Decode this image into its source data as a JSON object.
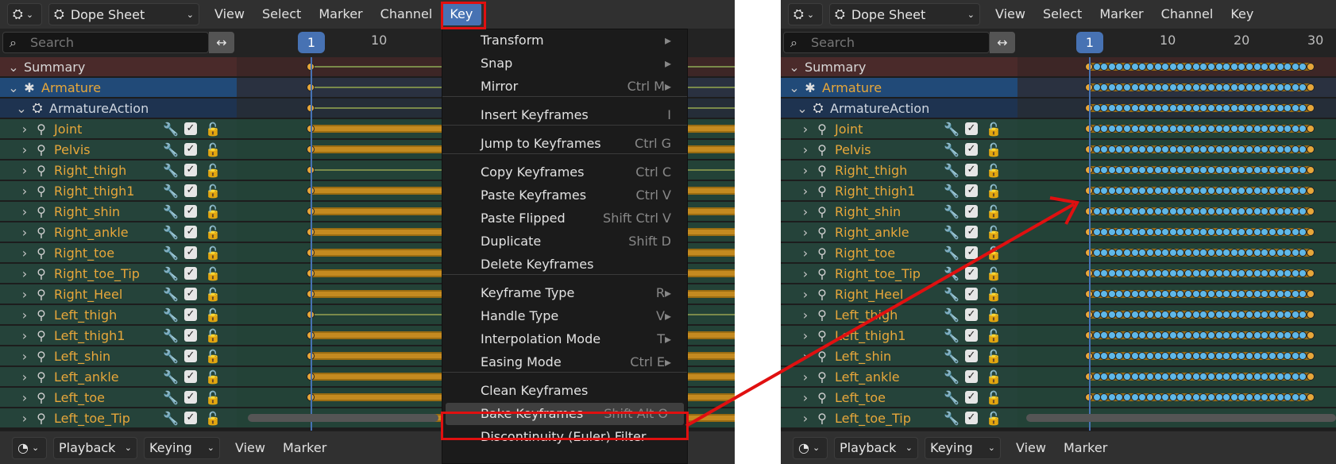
{
  "header": {
    "editor_icon": "dope-sheet-icon",
    "editor_type": "Dope Sheet",
    "menus": [
      "View",
      "Select",
      "Marker",
      "Channel",
      "Key"
    ]
  },
  "search": {
    "placeholder": "Search",
    "swap_icon": "↔"
  },
  "timeline": {
    "current_frame": "1",
    "left_ticks": [
      "10"
    ],
    "right_ticks": [
      "10",
      "20",
      "30"
    ]
  },
  "channels": {
    "summary": "Summary",
    "object": "Armature",
    "action": "ArmatureAction",
    "bones": [
      "Joint",
      "Pelvis",
      "Right_thigh",
      "Right_thigh1",
      "Right_shin",
      "Right_ankle",
      "Right_toe",
      "Right_toe_Tip",
      "Right_Heel",
      "Left_thigh",
      "Left_thigh1",
      "Left_shin",
      "Left_ankle",
      "Left_toe",
      "Left_toe_Tip"
    ]
  },
  "key_menu": {
    "items": [
      {
        "label": "Transform",
        "shortcut": "▸"
      },
      {
        "label": "Snap",
        "shortcut": "▸"
      },
      {
        "label": "Mirror",
        "shortcut": "Ctrl M▸"
      },
      {
        "label": "Insert Keyframes",
        "shortcut": "I"
      },
      {
        "label": "Jump to Keyframes",
        "shortcut": "Ctrl G"
      },
      {
        "label": "Copy Keyframes",
        "shortcut": "Ctrl C"
      },
      {
        "label": "Paste Keyframes",
        "shortcut": "Ctrl V"
      },
      {
        "label": "Paste Flipped",
        "shortcut": "Shift Ctrl V"
      },
      {
        "label": "Duplicate",
        "shortcut": "Shift D"
      },
      {
        "label": "Delete Keyframes",
        "shortcut": ""
      },
      {
        "label": "Keyframe Type",
        "shortcut": "R▸"
      },
      {
        "label": "Handle Type",
        "shortcut": "V▸"
      },
      {
        "label": "Interpolation Mode",
        "shortcut": "T▸"
      },
      {
        "label": "Easing Mode",
        "shortcut": "Ctrl E▸"
      },
      {
        "label": "Clean Keyframes",
        "shortcut": ""
      },
      {
        "label": "Bake Keyframes",
        "shortcut": "Shift Alt O"
      },
      {
        "label": "Discontinuity (Euler) Filter",
        "shortcut": ""
      }
    ]
  },
  "footer": {
    "playback": "Playback",
    "keying": "Keying",
    "view": "View",
    "marker": "Marker"
  },
  "colors": {
    "accent": "#4772b3",
    "highlight": "#e01010",
    "keyframe": "#e7a73a",
    "baked_key": "#5fb8e8"
  }
}
